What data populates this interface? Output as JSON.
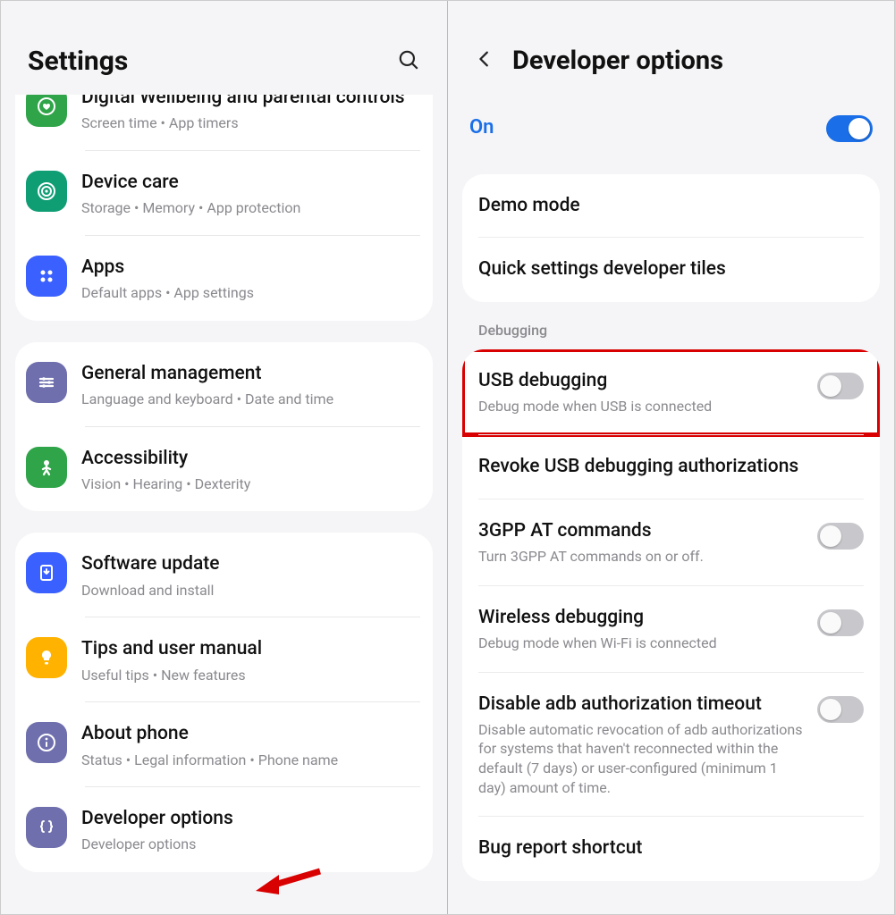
{
  "left": {
    "title": "Settings",
    "groups": [
      {
        "items": [
          {
            "icon": "heart",
            "iconBg": "#2fa449",
            "title": "Digital Wellbeing and parental controls",
            "sub": "Screen time  •  App timers"
          },
          {
            "icon": "spiral",
            "iconBg": "#0f9d74",
            "title": "Device care",
            "sub": "Storage  •  Memory  •  App protection"
          },
          {
            "icon": "apps",
            "iconBg": "#3a60ff",
            "title": "Apps",
            "sub": "Default apps  •  App settings"
          }
        ]
      },
      {
        "items": [
          {
            "icon": "sliders",
            "iconBg": "#6f6fae",
            "title": "General management",
            "sub": "Language and keyboard  •  Date and time"
          },
          {
            "icon": "person",
            "iconBg": "#2fa449",
            "title": "Accessibility",
            "sub": "Vision  •  Hearing  •  Dexterity"
          }
        ]
      },
      {
        "items": [
          {
            "icon": "download",
            "iconBg": "#3a60ff",
            "title": "Software update",
            "sub": "Download and install"
          },
          {
            "icon": "bulb",
            "iconBg": "#ffb300",
            "title": "Tips and user manual",
            "sub": "Useful tips  •  New features"
          },
          {
            "icon": "info",
            "iconBg": "#6f6fae",
            "title": "About phone",
            "sub": "Status  •  Legal information  •  Phone name"
          },
          {
            "icon": "braces",
            "iconBg": "#6f6fae",
            "title": "Developer options",
            "sub": "Developer options"
          }
        ]
      }
    ]
  },
  "right": {
    "title": "Developer options",
    "enabled_label": "On",
    "top_items": [
      {
        "title": "Demo mode"
      },
      {
        "title": "Quick settings developer tiles"
      }
    ],
    "section_label": "Debugging",
    "debug_items": [
      {
        "title": "USB debugging",
        "sub": "Debug mode when USB is connected",
        "toggle": "off",
        "highlight": true
      },
      {
        "title": "Revoke USB debugging authorizations"
      },
      {
        "title": "3GPP AT commands",
        "sub": "Turn 3GPP AT commands on or off.",
        "toggle": "off"
      },
      {
        "title": "Wireless debugging",
        "sub": "Debug mode when Wi-Fi is connected",
        "toggle": "off"
      },
      {
        "title": "Disable adb authorization timeout",
        "sub": "Disable automatic revocation of adb authorizations for systems that haven't reconnected within the default (7 days) or user-configured (minimum 1 day) amount of time.",
        "toggle": "off"
      },
      {
        "title": "Bug report shortcut"
      }
    ]
  }
}
